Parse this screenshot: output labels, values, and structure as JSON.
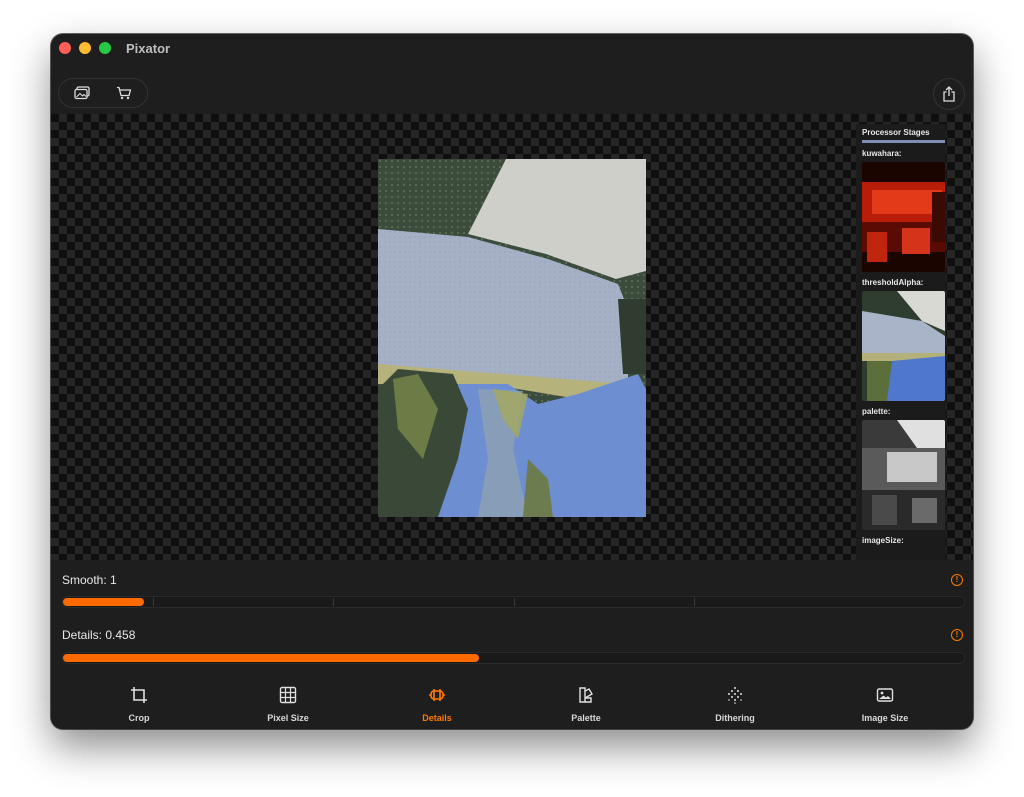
{
  "app": {
    "title": "Pixator"
  },
  "toolbar": {
    "left_buttons": [
      "photo-library-icon",
      "cart-icon"
    ],
    "right_button": "share-icon"
  },
  "stages": {
    "title": "Processor Stages",
    "items": [
      {
        "label": "kuwahara:"
      },
      {
        "label": "thresholdAlpha:"
      },
      {
        "label": "palette:"
      },
      {
        "label": "imageSize:"
      }
    ]
  },
  "controls": {
    "smooth": {
      "label": "Smooth: 1",
      "value": 1,
      "fraction": 0.09,
      "steps": 5
    },
    "details": {
      "label": "Details: 0.458",
      "value": 0.458,
      "fraction": 0.462
    }
  },
  "tabs": [
    {
      "label": "Crop",
      "icon": "crop-icon",
      "active": false
    },
    {
      "label": "Pixel Size",
      "icon": "grid-icon",
      "active": false
    },
    {
      "label": "Details",
      "icon": "details-icon",
      "active": true
    },
    {
      "label": "Palette",
      "icon": "palette-icon",
      "active": false
    },
    {
      "label": "Dithering",
      "icon": "dithering-icon",
      "active": false
    },
    {
      "label": "Image Size",
      "icon": "image-size-icon",
      "active": false
    }
  ],
  "colors": {
    "accent": "#ff6a00",
    "background": "#1e1e1e"
  }
}
